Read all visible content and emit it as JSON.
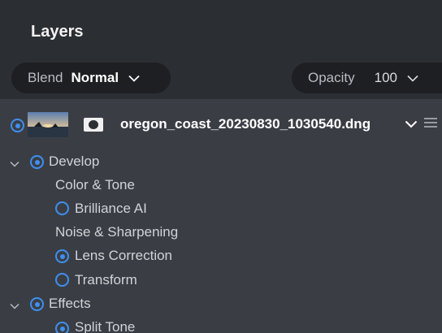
{
  "panel": {
    "title": "Layers",
    "blend": {
      "label": "Blend",
      "value": "Normal"
    },
    "opacity": {
      "label": "Opacity",
      "value": "100"
    }
  },
  "layer": {
    "filename": "oregon_coast_20230830_1030540.dng",
    "thumbnail_icon": "landscape-thumbnail",
    "mask_icon": "mask-icon",
    "selected": true
  },
  "tree": {
    "develop": {
      "label": "Develop",
      "groups": [
        {
          "label": "Color & Tone",
          "items": [
            {
              "label": "Brilliance AI",
              "active": false
            }
          ]
        },
        {
          "label": "Noise & Sharpening",
          "items": [
            {
              "label": "Lens Correction",
              "active": true
            },
            {
              "label": "Transform",
              "active": false
            }
          ]
        }
      ]
    },
    "effects": {
      "label": "Effects",
      "items": [
        {
          "label": "Split Tone",
          "active": true
        }
      ]
    }
  },
  "colors": {
    "accent": "#3f8ff0",
    "header_bg": "#2b2e32",
    "body_bg": "#3a3e44",
    "pill_bg": "#1d1f22"
  }
}
